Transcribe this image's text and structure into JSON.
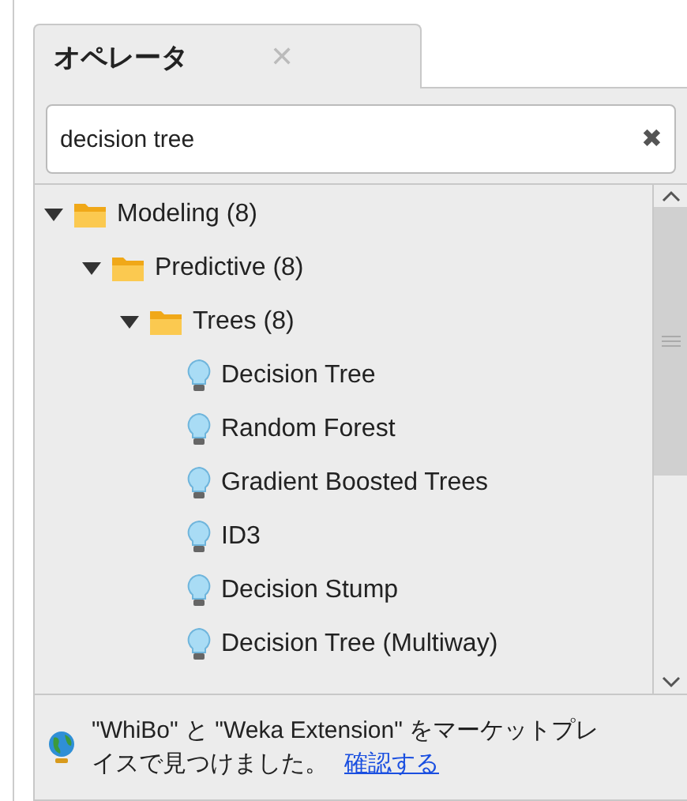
{
  "tab": {
    "label": "オペレータ",
    "close": "✕"
  },
  "search": {
    "value": "decision tree",
    "clear": "✖"
  },
  "tree": [
    {
      "label": "Modeling (8)",
      "kind": "folder",
      "expanded": true,
      "children": [
        {
          "label": "Predictive (8)",
          "kind": "folder",
          "expanded": true,
          "children": [
            {
              "label": "Trees (8)",
              "kind": "folder",
              "expanded": true,
              "children": [
                {
                  "label": "Decision Tree",
                  "kind": "operator"
                },
                {
                  "label": "Random Forest",
                  "kind": "operator"
                },
                {
                  "label": "Gradient Boosted Trees",
                  "kind": "operator"
                },
                {
                  "label": "ID3",
                  "kind": "operator"
                },
                {
                  "label": "Decision Stump",
                  "kind": "operator"
                },
                {
                  "label": "Decision Tree (Multiway)",
                  "kind": "operator"
                }
              ]
            }
          ]
        }
      ]
    }
  ],
  "notice": {
    "text": "\"WhiBo\" と \"Weka Extension\" をマーケットプレイスで見つけました。",
    "link": "確認する"
  }
}
